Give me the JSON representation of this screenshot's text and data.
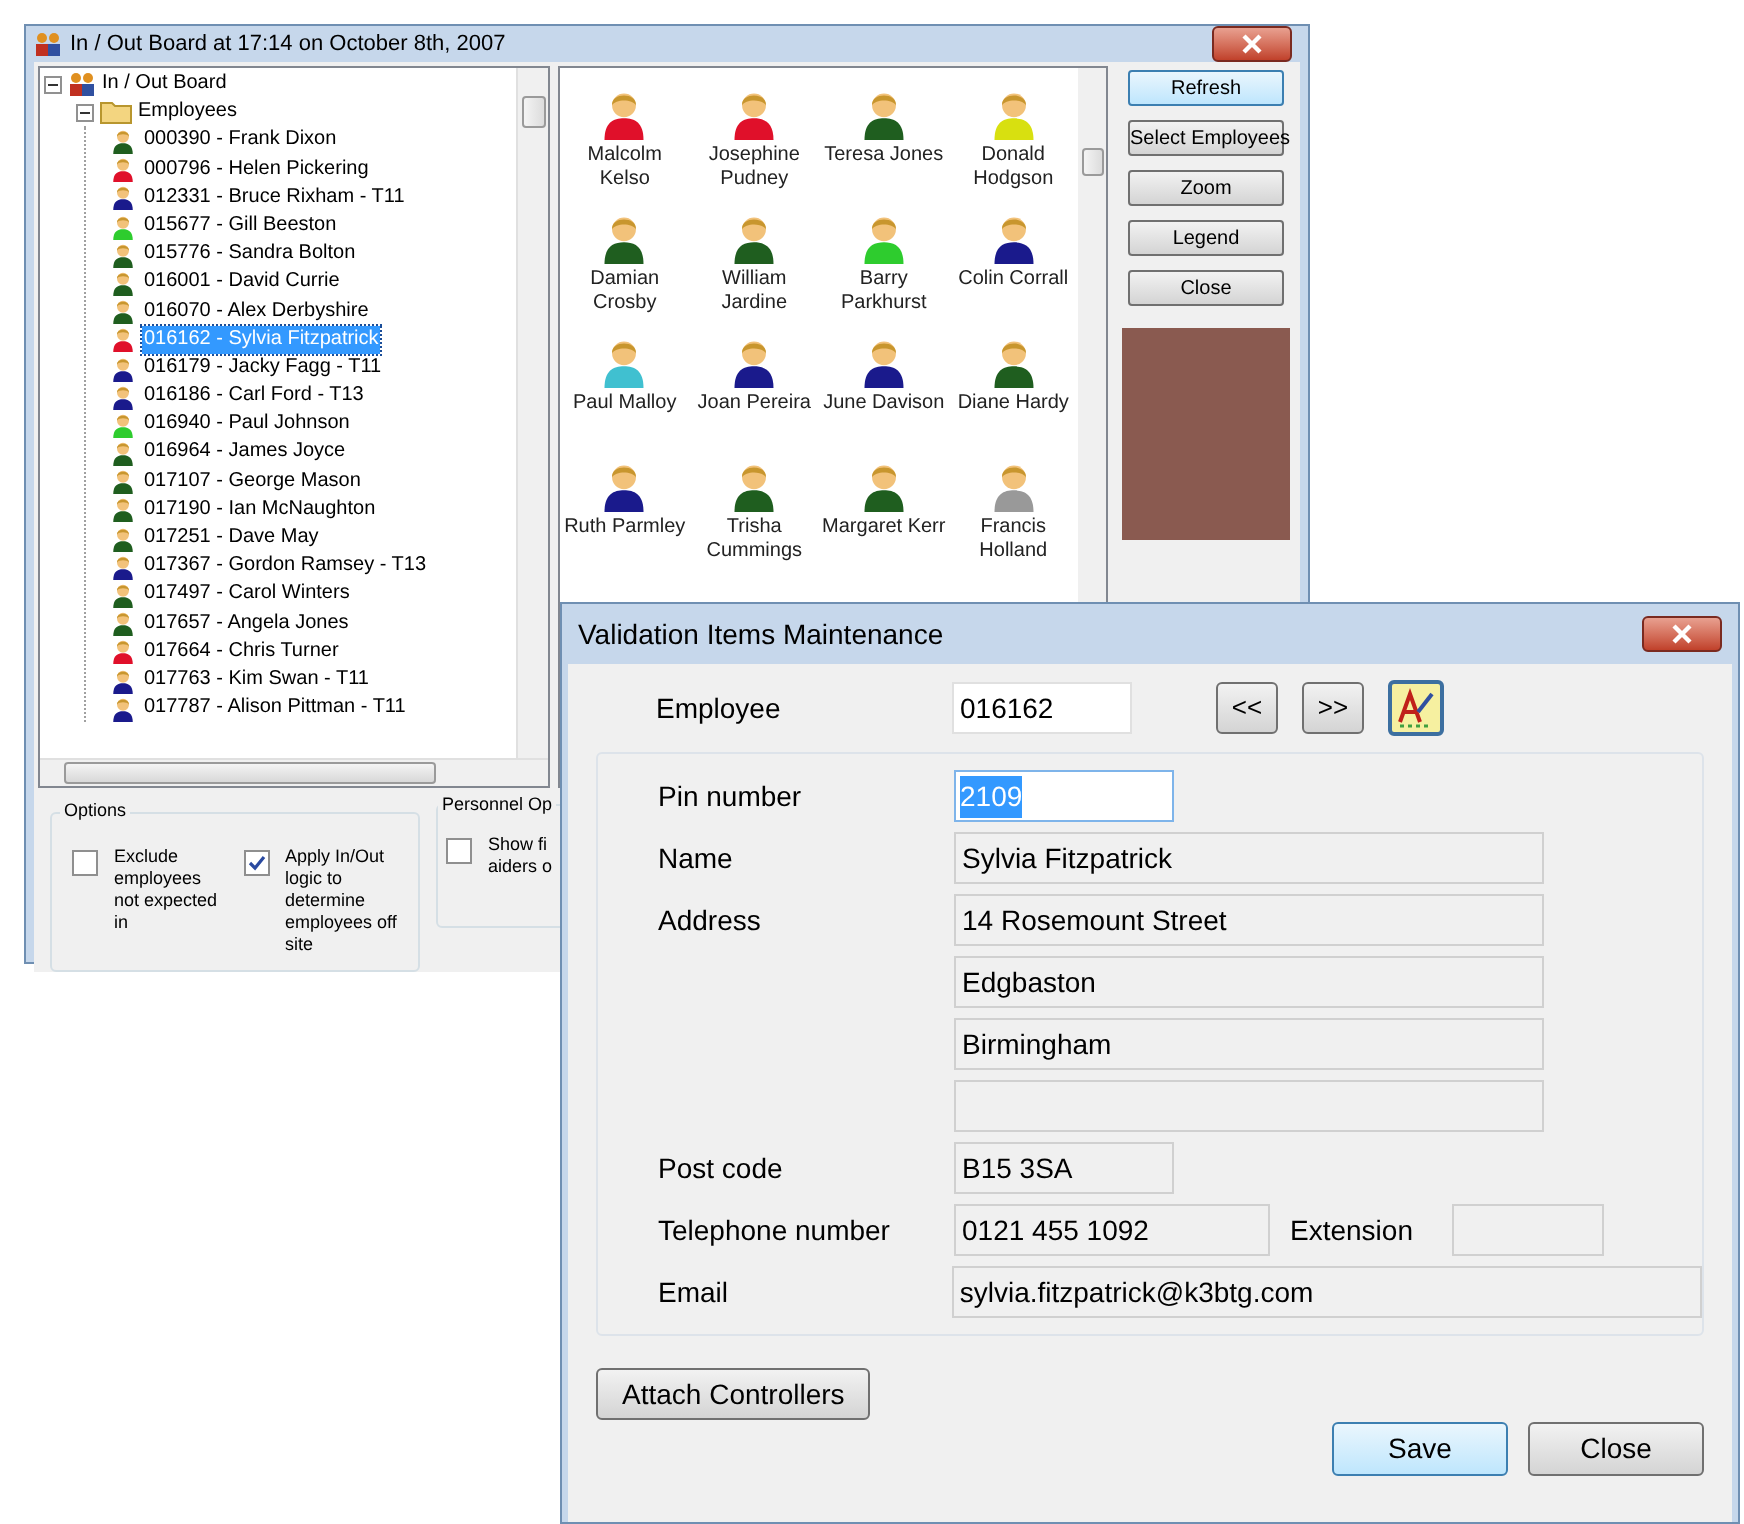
{
  "board_window": {
    "title": "In / Out Board at 17:14 on October 8th, 2007",
    "tree": {
      "root": "In / Out Board",
      "expanded": true,
      "children": [
        {
          "label": "Employees",
          "expanded": true,
          "children": [
            {
              "label": "000390 - Frank Dixon",
              "color": "#1f5e1f",
              "selected": false
            },
            {
              "label": "000796 - Helen Pickering",
              "color": "#e0102a",
              "selected": false
            },
            {
              "label": "012331 - Bruce Rixham - T11",
              "color": "#1a1a8c",
              "selected": false
            },
            {
              "label": "015677 - Gill Beeston",
              "color": "#2ecc2e",
              "selected": false
            },
            {
              "label": "015776 - Sandra Bolton",
              "color": "#1f5e1f",
              "selected": false
            },
            {
              "label": "016001 - David Currie",
              "color": "#1f5e1f",
              "selected": false
            },
            {
              "label": "016070 - Alex Derbyshire",
              "color": "#1f5e1f",
              "selected": false
            },
            {
              "label": "016162 - Sylvia Fitzpatrick",
              "color": "#e0102a",
              "selected": true
            },
            {
              "label": "016179 - Jacky Fagg - T11",
              "color": "#1a1a8c",
              "selected": false
            },
            {
              "label": "016186 - Carl Ford - T13",
              "color": "#1a1a8c",
              "selected": false
            },
            {
              "label": "016940 - Paul Johnson",
              "color": "#2ecc2e",
              "selected": false
            },
            {
              "label": "016964 - James Joyce",
              "color": "#1f5e1f",
              "selected": false
            },
            {
              "label": "017107 - George Mason",
              "color": "#1f5e1f",
              "selected": false
            },
            {
              "label": "017190 - Ian McNaughton",
              "color": "#1f5e1f",
              "selected": false
            },
            {
              "label": "017251 - Dave May",
              "color": "#1f5e1f",
              "selected": false
            },
            {
              "label": "017367 - Gordon Ramsey - T13",
              "color": "#1a1a8c",
              "selected": false
            },
            {
              "label": "017497 - Carol Winters",
              "color": "#1f5e1f",
              "selected": false
            },
            {
              "label": "017657 - Angela Jones",
              "color": "#1f5e1f",
              "selected": false
            },
            {
              "label": "017664 - Chris Turner",
              "color": "#e0102a",
              "selected": false
            },
            {
              "label": "017763 - Kim Swan - T11",
              "color": "#1a1a8c",
              "selected": false
            },
            {
              "label": "017787 - Alison Pittman - T11",
              "color": "#1a1a8c",
              "selected": false
            }
          ]
        }
      ]
    },
    "people": [
      {
        "name": "Malcolm Kelso",
        "color": "#e0102a"
      },
      {
        "name": "Josephine Pudney",
        "color": "#e0102a"
      },
      {
        "name": "Teresa Jones",
        "color": "#1f5e1f"
      },
      {
        "name": "Donald Hodgson",
        "color": "#d8e010"
      },
      {
        "name": "Damian Crosby",
        "color": "#1f5e1f"
      },
      {
        "name": "William Jardine",
        "color": "#1f5e1f"
      },
      {
        "name": "Barry Parkhurst",
        "color": "#2ecc2e"
      },
      {
        "name": "Colin Corrall",
        "color": "#1a1a8c"
      },
      {
        "name": "Paul Malloy",
        "color": "#40c0d0"
      },
      {
        "name": "Joan Pereira",
        "color": "#1a1a8c"
      },
      {
        "name": "June Davison",
        "color": "#1a1a8c"
      },
      {
        "name": "Diane Hardy",
        "color": "#1f5e1f"
      },
      {
        "name": "Ruth Parmley",
        "color": "#1a1a8c"
      },
      {
        "name": "Trisha Cummings",
        "color": "#1f5e1f"
      },
      {
        "name": "Margaret Kerr",
        "color": "#1f5e1f"
      },
      {
        "name": "Francis Holland",
        "color": "#999999"
      }
    ],
    "buttons": [
      {
        "label": "Refresh",
        "focused": true
      },
      {
        "label": "Select Employees",
        "focused": false
      },
      {
        "label": "Zoom",
        "focused": false
      },
      {
        "label": "Legend",
        "focused": false
      },
      {
        "label": "Close",
        "focused": false
      }
    ],
    "options": {
      "title": "Options",
      "items": [
        {
          "label": "Exclude employees not expected in",
          "checked": false
        },
        {
          "label": "Apply In/Out logic to determine employees off site",
          "checked": true
        }
      ]
    },
    "personnel_options": {
      "title": "Personnel Op",
      "items": [
        {
          "label": "Show fi aiders o",
          "checked": false
        }
      ]
    }
  },
  "dialog": {
    "title": "Validation Items Maintenance",
    "employee": {
      "label": "Employee",
      "value": "016162"
    },
    "nav_buttons": [
      "<<",
      ">>"
    ],
    "fields": [
      {
        "label": "Pin number",
        "value": "2109",
        "kind": "input",
        "highlighted": true
      },
      {
        "label": "Name",
        "value": "Sylvia Fitzpatrick",
        "kind": "long"
      },
      {
        "label": "Address",
        "value": "14 Rosemount Street",
        "kind": "long"
      },
      {
        "value": "Edgbaston",
        "kind": "long"
      },
      {
        "value": "Birmingham",
        "kind": "long"
      },
      {
        "kind": "long"
      },
      {
        "label": "Post code",
        "value": "B15 3SA",
        "kind": "short"
      },
      {
        "label": "Telephone number",
        "value": "0121 455 1092",
        "kind": "phone",
        "extension_label": "Extension"
      },
      {
        "label": "Email",
        "value": "sylvia.fitzpatrick@k3btg.com",
        "kind": "full"
      }
    ],
    "attach_button": "Attach Controllers",
    "footer_buttons": [
      {
        "label": "Save",
        "focused": true
      },
      {
        "label": "Close",
        "focused": false
      }
    ]
  }
}
